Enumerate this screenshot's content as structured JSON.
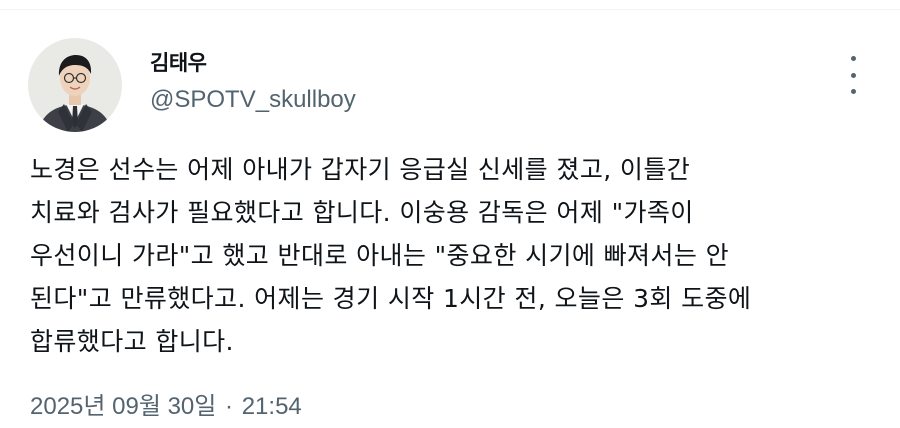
{
  "author": {
    "display_name": "김태우",
    "handle": "@SPOTV_skullboy"
  },
  "tweet": {
    "lines": [
      "노경은 선수는 어제 아내가 갑자기 응급실 신세를 졌고, 이틀간",
      "치료와 검사가 필요했다고 합니다. 이숭용 감독은 어제 \"가족이",
      "우선이니 가라\"고 했고 반대로 아내는 \"중요한 시기에 빠져서는 안",
      "된다\"고 만류했다고. 어제는 경기 시작 1시간 전, 오늘은 3회 도중에",
      "합류했다고 합니다."
    ]
  },
  "meta": {
    "date": "2025년 09월 30일",
    "separator": "·",
    "time": "21:54"
  },
  "icons": {
    "more": "more-vertical-icon",
    "avatar": "avatar"
  },
  "colors": {
    "text": "#0f1419",
    "secondary": "#536471"
  }
}
